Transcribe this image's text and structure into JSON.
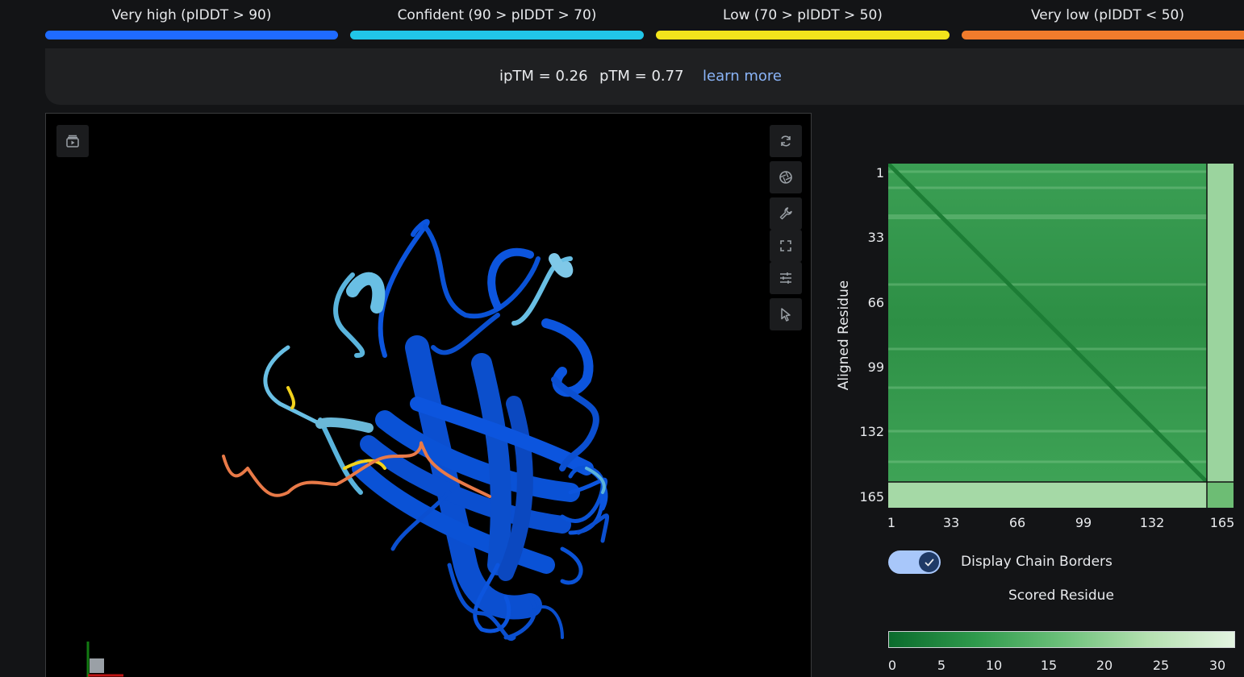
{
  "legend": [
    {
      "label": "Very high (pIDDT > 90)",
      "color": "#1f6bff"
    },
    {
      "label": "Confident (90 > pIDDT > 70)",
      "color": "#21c6e8"
    },
    {
      "label": "Low (70 > pIDDT > 50)",
      "color": "#f2e41c"
    },
    {
      "label": "Very low (pIDDT < 50)",
      "color": "#f17c2c"
    }
  ],
  "scores": {
    "iptm": "ipTM = 0.26",
    "ptm": "pTM = 0.77",
    "learn_more": "learn more"
  },
  "viewer": {
    "tools": [
      "rotate-icon",
      "camera-icon",
      "wrench-icon",
      "fullscreen-icon",
      "sliders-icon",
      "pointer-icon"
    ]
  },
  "pae": {
    "ylabel": "Aligned Residue",
    "yticks": [
      "1",
      "33",
      "66",
      "99",
      "132",
      "165"
    ],
    "xticks": [
      "1",
      "33",
      "66",
      "99",
      "132",
      "165"
    ],
    "toggle_label": "Display Chain Borders",
    "toggle_on": true,
    "xlabel": "Scored Residue",
    "colorbar_ticks": [
      "0",
      "5",
      "10",
      "15",
      "20",
      "25",
      "30"
    ]
  }
}
